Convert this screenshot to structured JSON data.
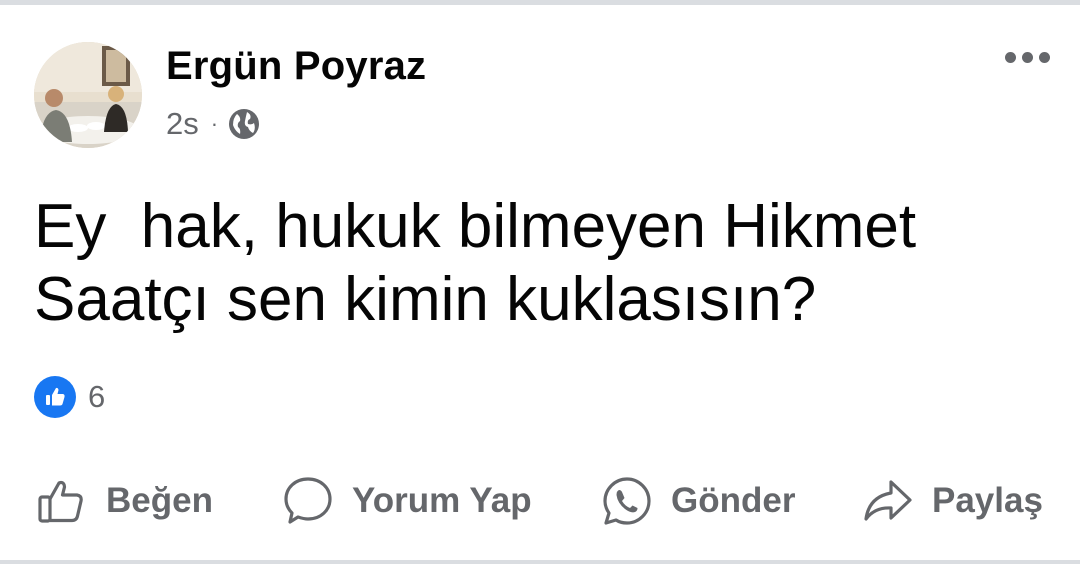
{
  "post": {
    "author_name": "Ergün Poyraz",
    "timestamp": "2s",
    "separator": "·",
    "audience_icon": "globe-icon",
    "text": "Ey  hak, hukuk bilmeyen Hikmet\nSaatçı sen kimin kuklasısın?",
    "reactions": {
      "icon": "like-reaction-icon",
      "count": "6"
    }
  },
  "actions": {
    "like_label": "Beğen",
    "comment_label": "Yorum Yap",
    "send_label": "Gönder",
    "share_label": "Paylaş"
  },
  "colors": {
    "accent_blue": "#1877f2",
    "secondary_text": "#65676b",
    "primary_text": "#050505",
    "divider": "#dadde1"
  }
}
